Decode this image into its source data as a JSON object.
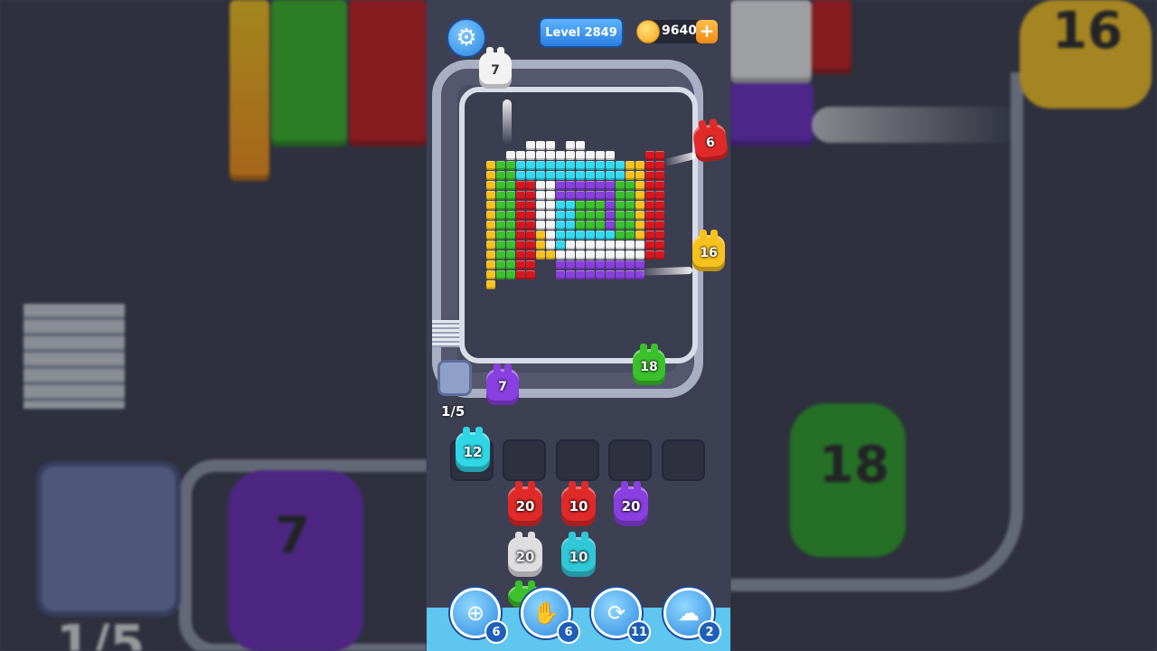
{
  "header": {
    "settings_icon": "gear-icon",
    "level_label": "Level 2849",
    "coins": "9640",
    "coins_plus": "+"
  },
  "board_shooters": [
    {
      "value": "7",
      "color": "#f2f2f2"
    },
    {
      "value": "6",
      "color": "#e02a2a"
    },
    {
      "value": "16",
      "color": "#f7c21d"
    },
    {
      "value": "18",
      "color": "#3ac12c"
    },
    {
      "value": "7",
      "color": "#8a3fe0"
    }
  ],
  "counter": "1/5",
  "slots": [
    {
      "filled": true,
      "value": "12",
      "color": "#2fd6e6"
    },
    {
      "filled": false
    },
    {
      "filled": false
    },
    {
      "filled": false
    },
    {
      "filled": false
    }
  ],
  "queue": [
    {
      "value": "20",
      "color": "#e02a2a"
    },
    {
      "value": "10",
      "color": "#e02a2a"
    },
    {
      "value": "20",
      "color": "#8a3fe0"
    },
    {
      "value": "20",
      "color": "#f0f0f0"
    },
    {
      "value": "10",
      "color": "#2fd6e6"
    }
  ],
  "tools": [
    {
      "icon": "add-slot-icon",
      "count": "6"
    },
    {
      "icon": "hand-icon",
      "count": "6"
    },
    {
      "icon": "shuffle-icon",
      "count": "11"
    },
    {
      "icon": "ghost-icon",
      "count": "2"
    }
  ],
  "backdrop": {
    "left_counter": "1/5",
    "left_figure": "7",
    "right_figure_top": "16",
    "right_figure": "18"
  }
}
